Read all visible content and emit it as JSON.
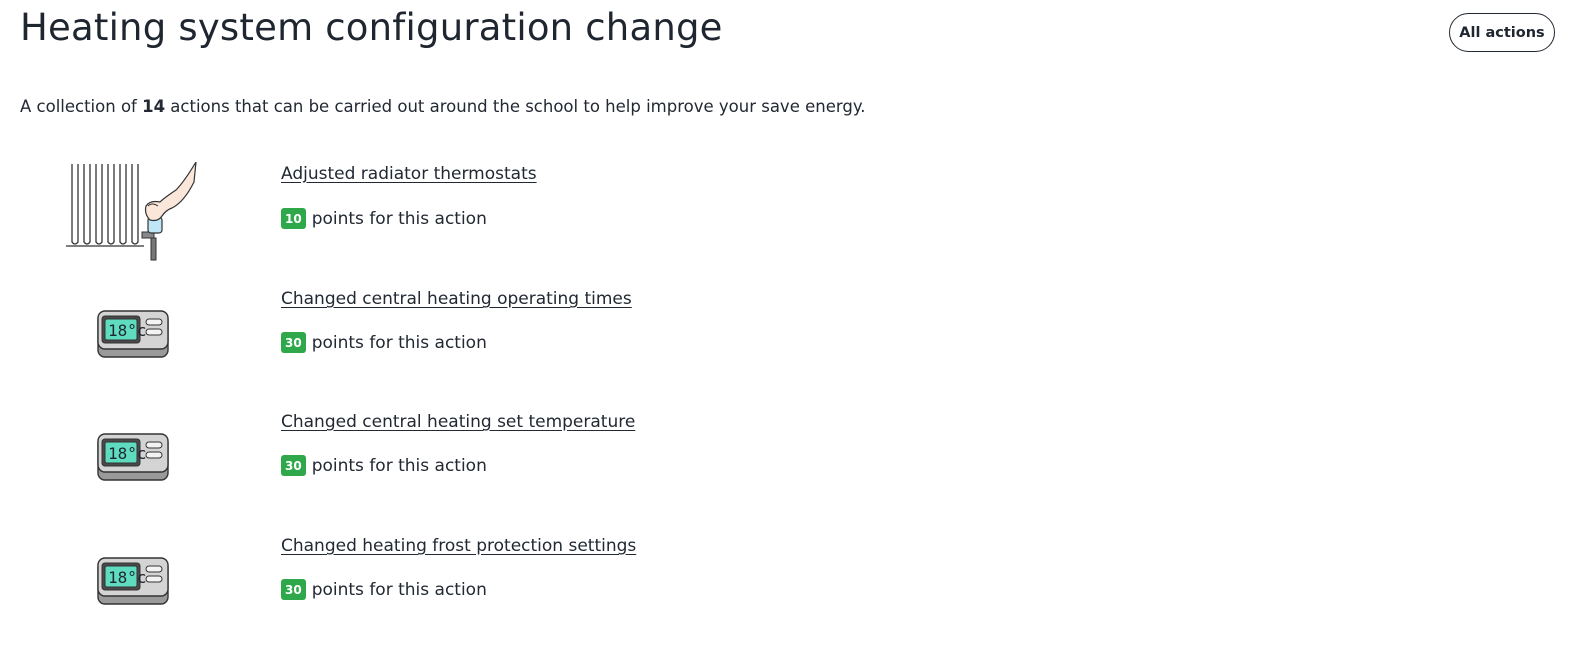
{
  "header": {
    "title": "Heating system configuration change",
    "all_actions_label": "All actions"
  },
  "intro": {
    "prefix": "A collection of ",
    "count": "14",
    "suffix": " actions that can be carried out around the school to help improve your save energy."
  },
  "actions": [
    {
      "title": "Adjusted radiator thermostats",
      "points": "10",
      "points_suffix": "points for this action",
      "icon": "radiator-thermostat-icon"
    },
    {
      "title": "Changed central heating operating times",
      "points": "30",
      "points_suffix": "points for this action",
      "icon": "thermostat-display-icon"
    },
    {
      "title": "Changed central heating set temperature",
      "points": "30",
      "points_suffix": "points for this action",
      "icon": "thermostat-display-icon"
    },
    {
      "title": "Changed heating frost protection settings",
      "points": "30",
      "points_suffix": "points for this action",
      "icon": "thermostat-display-icon"
    }
  ],
  "thermostat_display_text": "18°c",
  "colors": {
    "badge": "#2ea84a",
    "text": "#222933",
    "thermostat_screen": "#5fdcc0"
  }
}
